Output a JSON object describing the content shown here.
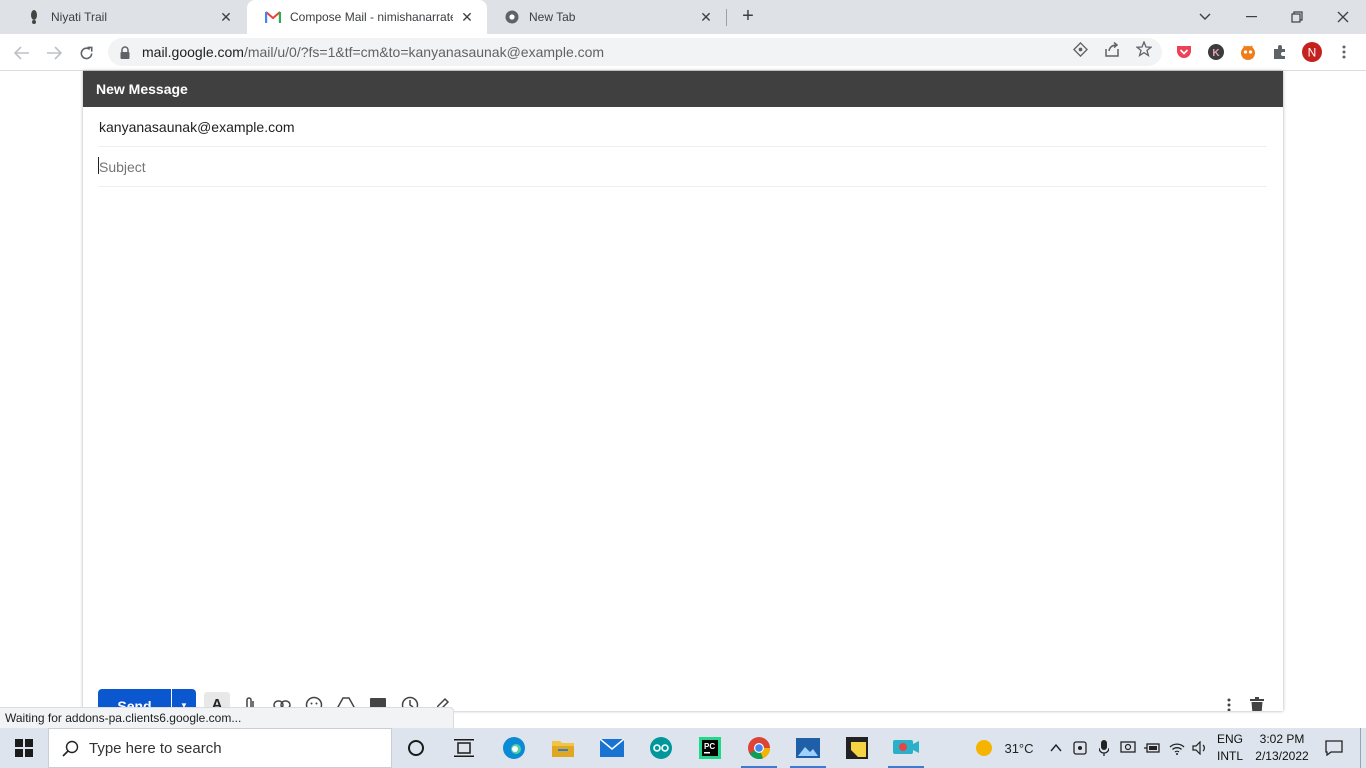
{
  "browser": {
    "tabs": [
      {
        "title": "Niyati Trail",
        "favicon": "footprint-icon",
        "active": false
      },
      {
        "title": "Compose Mail - nimishanarrates@",
        "favicon": "gmail-icon",
        "active": true
      },
      {
        "title": "New Tab",
        "favicon": "chrome-icon",
        "active": false
      }
    ],
    "url_host": "mail.google.com",
    "url_path": "/mail/u/0/?fs=1&tf=cm&to=kanyanasaunak@example.com",
    "profile_initial": "N",
    "extension_initial": "K"
  },
  "compose": {
    "header": "New Message",
    "to": "kanyanasaunak@example.com",
    "subject_placeholder": "Subject",
    "send_label": "Send"
  },
  "status_text": "Waiting for addons-pa.clients6.google.com...",
  "taskbar": {
    "search_placeholder": "Type here to search",
    "weather": "31°C",
    "lang_1": "ENG",
    "lang_2": "INTL",
    "time": "3:02 PM",
    "date": "2/13/2022"
  },
  "colors": {
    "gmail_red": "#ea4335",
    "send_blue": "#0b57d0",
    "compose_header": "#404040",
    "profile_bg": "#c5221f"
  }
}
